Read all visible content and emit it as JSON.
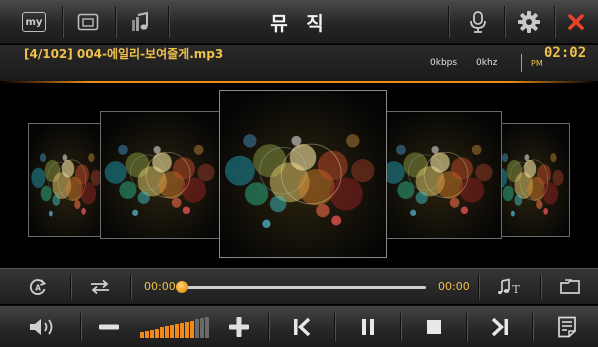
{
  "app": {
    "title": "뮤 직",
    "colors": {
      "accent": "#f0c14a",
      "close": "#e8422a",
      "progress": "#f0a020"
    }
  },
  "topbar": {
    "my_label": "my",
    "icons": [
      "my-icon",
      "window-icon",
      "music-note-icon",
      "microphone-icon",
      "gear-icon",
      "close-icon"
    ]
  },
  "track_info": {
    "track_text": "[4/102] 004-에일리-보여줄게.mp3",
    "bitrate": "0kbps",
    "samplerate": "0khz",
    "ampm": "PM",
    "clock": "02:02"
  },
  "coverflow": {
    "covers": [
      "album-cover-1",
      "album-cover-2",
      "album-cover-center",
      "album-cover-4",
      "album-cover-5"
    ]
  },
  "seek": {
    "elapsed": "00:00",
    "total": "00:00",
    "progress": 0,
    "icons": [
      "repeat-a-icon",
      "shuffle-icon",
      "music-info-icon",
      "folder-icon"
    ]
  },
  "controls": {
    "volume_level": 0.75,
    "icons": [
      "speaker-icon",
      "minus-icon",
      "volume-level-icon",
      "plus-icon",
      "previous-icon",
      "pause-icon",
      "stop-icon",
      "next-icon",
      "playlist-icon"
    ]
  }
}
